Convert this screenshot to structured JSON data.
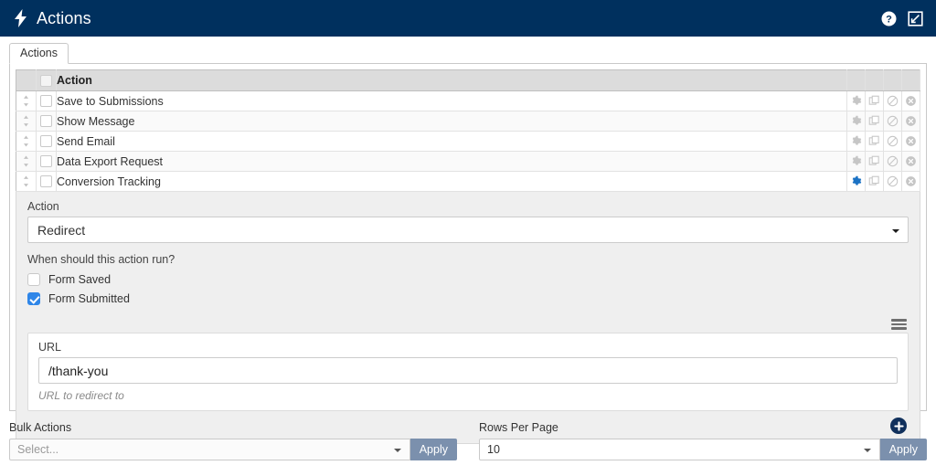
{
  "header": {
    "title": "Actions",
    "logo_icon": "lightning-bolt-icon",
    "help_icon": "help-circle-icon",
    "collapse_icon": "collapse-arrow-icon",
    "background_color": "#00305e"
  },
  "tabs": [
    {
      "label": "Actions",
      "active": true
    }
  ],
  "table": {
    "columns": [
      "",
      "",
      "Action",
      "",
      "",
      "",
      ""
    ],
    "action_column_header": "Action",
    "row_icons": [
      "gear-icon",
      "duplicate-icon",
      "disable-icon",
      "delete-icon"
    ],
    "rows": [
      {
        "name": "Save to Submissions",
        "checked": false,
        "active": false
      },
      {
        "name": "Show Message",
        "checked": false,
        "active": false
      },
      {
        "name": "Send Email",
        "checked": false,
        "active": false
      },
      {
        "name": "Data Export Request",
        "checked": false,
        "active": false
      },
      {
        "name": "Conversion Tracking",
        "checked": false,
        "active": true
      }
    ]
  },
  "settings": {
    "action_label": "Action",
    "action_value": "Redirect",
    "run_when_label": "When should this action run?",
    "checkboxes": [
      {
        "label": "Form Saved",
        "checked": false
      },
      {
        "label": "Form Submitted",
        "checked": true
      }
    ],
    "menu_icon": "hamburger-menu-icon",
    "url_label": "URL",
    "url_value": "/thank-you",
    "url_help": "URL to redirect to",
    "add_icon": "plus-circle-icon"
  },
  "footer": {
    "bulk_actions_label": "Bulk Actions",
    "bulk_actions_value": "Select...",
    "bulk_apply_label": "Apply",
    "rows_per_page_label": "Rows Per Page",
    "rows_per_page_value": "10",
    "rows_apply_label": "Apply"
  },
  "colors": {
    "header_navy": "#00305e",
    "accent_blue": "#1b72c4",
    "checkbox_blue": "#2f86e8",
    "apply_button": "#7b90ad"
  }
}
